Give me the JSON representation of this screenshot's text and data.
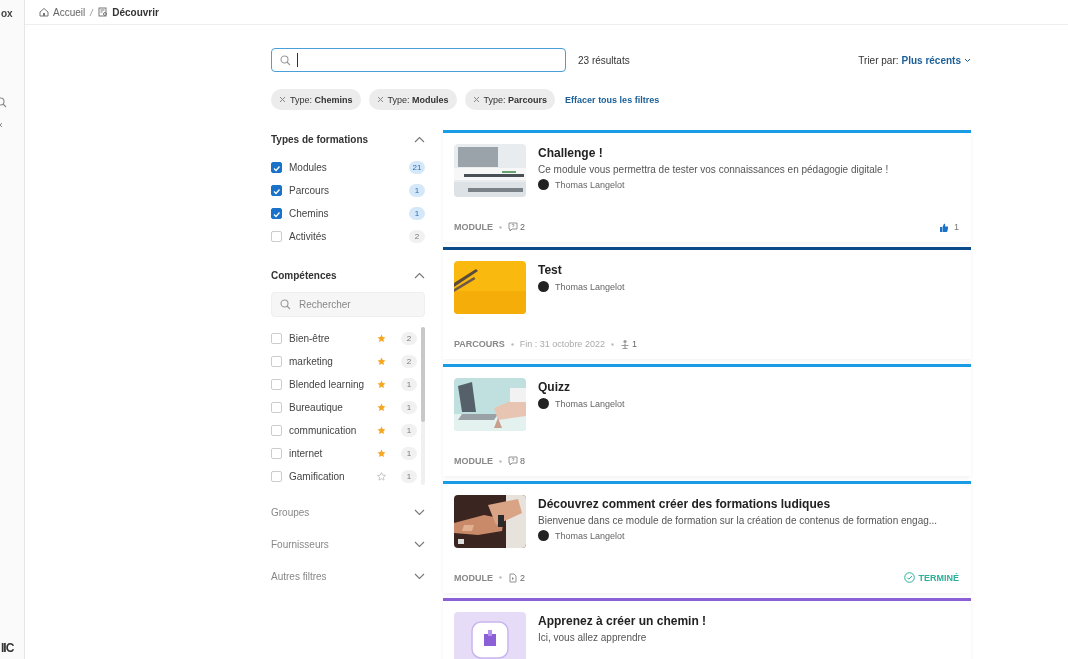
{
  "sidebar": {
    "top_text": "ox",
    "bottom_text": "IIC"
  },
  "breadcrumb": [
    {
      "label": "Accueil",
      "current": false
    },
    {
      "label": "Découvrir",
      "current": true
    }
  ],
  "results_count": "23 résultats",
  "sort": {
    "label": "Trier par:",
    "value": "Plus récents"
  },
  "active_filters": [
    {
      "prefix": "Type:",
      "value": "Chemins"
    },
    {
      "prefix": "Type:",
      "value": "Modules"
    },
    {
      "prefix": "Type:",
      "value": "Parcours"
    }
  ],
  "clear_filters": "Effacer tous les filtres",
  "filter_sections": [
    {
      "title": "Types de formations",
      "expanded": true,
      "items": [
        {
          "label": "Modules",
          "checked": true,
          "count": "21"
        },
        {
          "label": "Parcours",
          "checked": true,
          "count": "1"
        },
        {
          "label": "Chemins",
          "checked": true,
          "count": "1"
        },
        {
          "label": "Activités",
          "checked": false,
          "count": "2"
        }
      ]
    },
    {
      "title": "Compétences",
      "expanded": true,
      "search_placeholder": "Rechercher",
      "items": [
        {
          "label": "Bien-être",
          "checked": false,
          "starred": true,
          "count": "2"
        },
        {
          "label": "marketing",
          "checked": false,
          "starred": true,
          "count": "2"
        },
        {
          "label": "Blended learning",
          "checked": false,
          "starred": true,
          "count": "1"
        },
        {
          "label": "Bureautique",
          "checked": false,
          "starred": true,
          "count": "1"
        },
        {
          "label": "communication",
          "checked": false,
          "starred": true,
          "count": "1"
        },
        {
          "label": "internet",
          "checked": false,
          "starred": true,
          "count": "1"
        },
        {
          "label": "Gamification",
          "checked": false,
          "starred": false,
          "count": "1"
        }
      ]
    },
    {
      "title": "Groupes",
      "expanded": false
    },
    {
      "title": "Fournisseurs",
      "expanded": false
    },
    {
      "title": "Autres filtres",
      "expanded": false
    }
  ],
  "cards": [
    {
      "color": "#1a9be6",
      "thumbnail": {
        "kind": "picture"
      },
      "title": "Challenge !",
      "description": "Ce module vous permettra de tester vos connaissances en pédagogie digitale !",
      "author": "Thomas Langelot",
      "type": "MODULE",
      "meta": [
        {
          "kind": "questions",
          "text": "2"
        }
      ],
      "likes": "1"
    },
    {
      "color": "#0d4a8a",
      "thumbnail": {
        "kind": "picture"
      },
      "title": "Test",
      "author": "Thomas Langelot",
      "type": "PARCOURS",
      "meta": [
        {
          "kind": "date",
          "text": "Fin : 31 octobre 2022"
        },
        {
          "kind": "learners",
          "text": "1"
        }
      ]
    },
    {
      "color": "#1a9be6",
      "thumbnail": {
        "kind": "picture"
      },
      "title": "Quizz",
      "author": "Thomas Langelot",
      "type": "MODULE",
      "meta": [
        {
          "kind": "questions",
          "text": "8"
        }
      ]
    },
    {
      "color": "#1a9be6",
      "thumbnail": {
        "kind": "picture"
      },
      "title": "Découvrez comment créer des formations ludiques",
      "description": "Bienvenue dans ce module de formation sur la création de contenus de formation engag...",
      "author": "Thomas Langelot",
      "type": "MODULE",
      "meta": [
        {
          "kind": "pages",
          "text": "2"
        }
      ],
      "status": "TERMINÉ"
    },
    {
      "color": "#8b5fd6",
      "thumbnail": {
        "kind": "picture"
      },
      "title": "Apprenez à créer un chemin !",
      "description": "Ici, vous allez apprendre"
    }
  ]
}
